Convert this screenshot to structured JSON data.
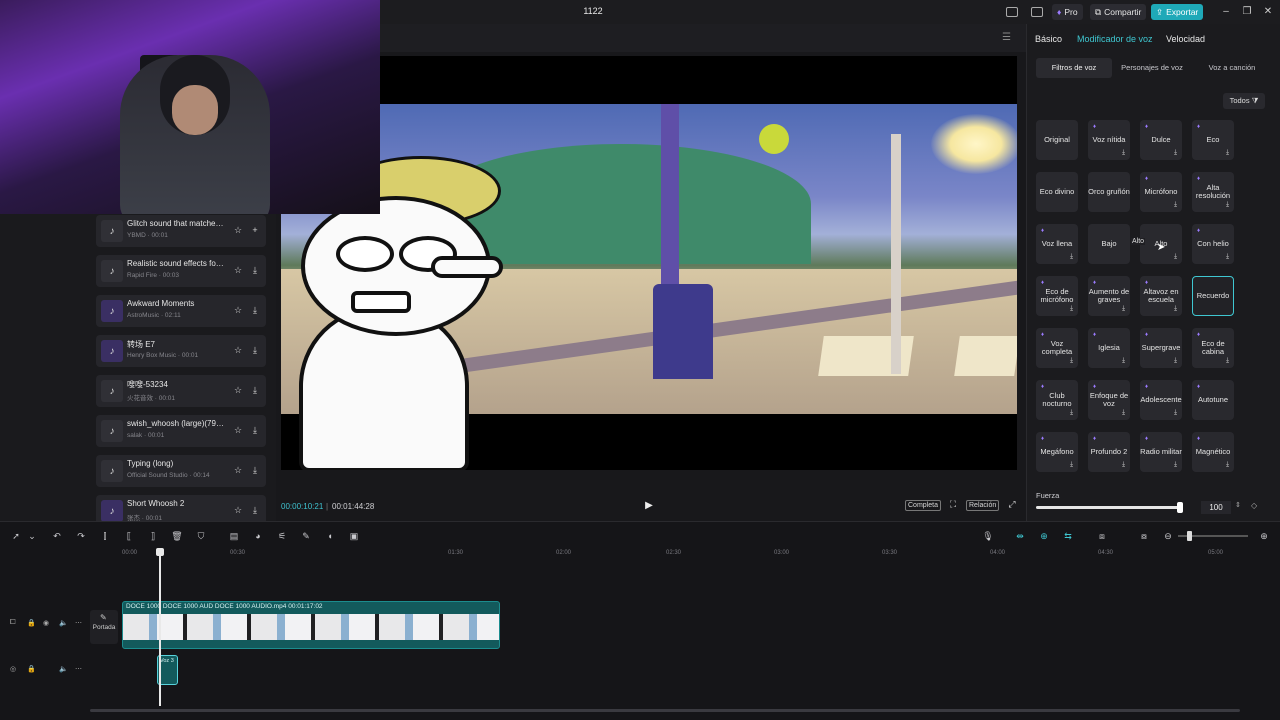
{
  "titlebar": {
    "title": "1122",
    "pro_label": "Pro",
    "share_label": "Compartir",
    "export_label": "Exportar"
  },
  "sounds": [
    {
      "name": "Glitch sound that matches...",
      "meta": "YBMD · 00:01",
      "premium": false
    },
    {
      "name": "Realistic sound effects for ...",
      "meta": "Rapid Fire · 00:03",
      "premium": false
    },
    {
      "name": "Awkward Moments",
      "meta": "AstroMusic · 02:11",
      "premium": true
    },
    {
      "name": "转场 E7",
      "meta": "Henry Box Music · 00:01",
      "premium": true
    },
    {
      "name": "嗖嗖-53234",
      "meta": "火花音效 · 00:01",
      "premium": false
    },
    {
      "name": "swish_whoosh (large)(794...",
      "meta": "salak · 00:01",
      "premium": false
    },
    {
      "name": "Typing (long)",
      "meta": "Official Sound Studio · 00:14",
      "premium": false
    },
    {
      "name": "Short Whoosh 2",
      "meta": "张杰 · 00:01",
      "premium": true
    }
  ],
  "player": {
    "current_time": "00:00:10:21",
    "total_time": "00:01:44:28",
    "full_label": "Completa",
    "ratio_label": "Relación"
  },
  "right": {
    "tabs": [
      "Básico",
      "Modificador de voz",
      "Velocidad"
    ],
    "subtabs": [
      "Filtros de voz",
      "Personajes de voz",
      "Voz a canción"
    ],
    "todos_label": "Todos",
    "tooltip": "Alto",
    "fuerza_label": "Fuerza",
    "fuerza_value": "100",
    "voices": [
      {
        "label": "Original",
        "premium": false,
        "download": false,
        "selected": false
      },
      {
        "label": "Voz nítida",
        "premium": true,
        "download": true,
        "selected": false
      },
      {
        "label": "Dulce",
        "premium": true,
        "download": true,
        "selected": false
      },
      {
        "label": "Eco",
        "premium": true,
        "download": true,
        "selected": false
      },
      {
        "label": "Eco divino",
        "premium": false,
        "download": false,
        "selected": false
      },
      {
        "label": "Orco gruñón",
        "premium": false,
        "download": false,
        "selected": false
      },
      {
        "label": "Micrófono",
        "premium": true,
        "download": true,
        "selected": false
      },
      {
        "label": "Alta resolución",
        "premium": true,
        "download": true,
        "selected": false
      },
      {
        "label": "Voz llena",
        "premium": true,
        "download": true,
        "selected": false
      },
      {
        "label": "Bajo",
        "premium": false,
        "download": false,
        "selected": false
      },
      {
        "label": "Alto",
        "premium": false,
        "download": true,
        "selected": false
      },
      {
        "label": "Con helio",
        "premium": true,
        "download": true,
        "selected": false
      },
      {
        "label": "Eco de micrófono",
        "premium": true,
        "download": true,
        "selected": false
      },
      {
        "label": "Aumento de graves",
        "premium": true,
        "download": true,
        "selected": false
      },
      {
        "label": "Altavoz en escuela",
        "premium": true,
        "download": true,
        "selected": false
      },
      {
        "label": "Recuerdo",
        "premium": false,
        "download": false,
        "selected": true
      },
      {
        "label": "Voz completa",
        "premium": true,
        "download": true,
        "selected": false
      },
      {
        "label": "Iglesia",
        "premium": true,
        "download": true,
        "selected": false
      },
      {
        "label": "Supergrave",
        "premium": true,
        "download": true,
        "selected": false
      },
      {
        "label": "Eco de cabina",
        "premium": true,
        "download": true,
        "selected": false
      },
      {
        "label": "Club nocturno",
        "premium": true,
        "download": true,
        "selected": false
      },
      {
        "label": "Enfoque de voz",
        "premium": true,
        "download": true,
        "selected": false
      },
      {
        "label": "Adolescente",
        "premium": true,
        "download": true,
        "selected": false
      },
      {
        "label": "Autotune",
        "premium": true,
        "download": false,
        "selected": false
      },
      {
        "label": "Megáfono",
        "premium": true,
        "download": true,
        "selected": false
      },
      {
        "label": "Profundo 2",
        "premium": true,
        "download": true,
        "selected": false
      },
      {
        "label": "Radio militar",
        "premium": true,
        "download": true,
        "selected": false
      },
      {
        "label": "Magnético",
        "premium": true,
        "download": true,
        "selected": false
      }
    ]
  },
  "timeline": {
    "ruler": [
      "00:00",
      "00:30",
      "01:30",
      "02:00",
      "02:30",
      "03:00",
      "03:30",
      "04:00",
      "04:30",
      "05:00"
    ],
    "portada_label": "Portada",
    "video_clip_title": "DOCE 1000  DOCE 1000 AUD  DOCE 1000 AUDIO.mp4  00:01:17:02",
    "audio_clip_label": "Voz 3"
  }
}
